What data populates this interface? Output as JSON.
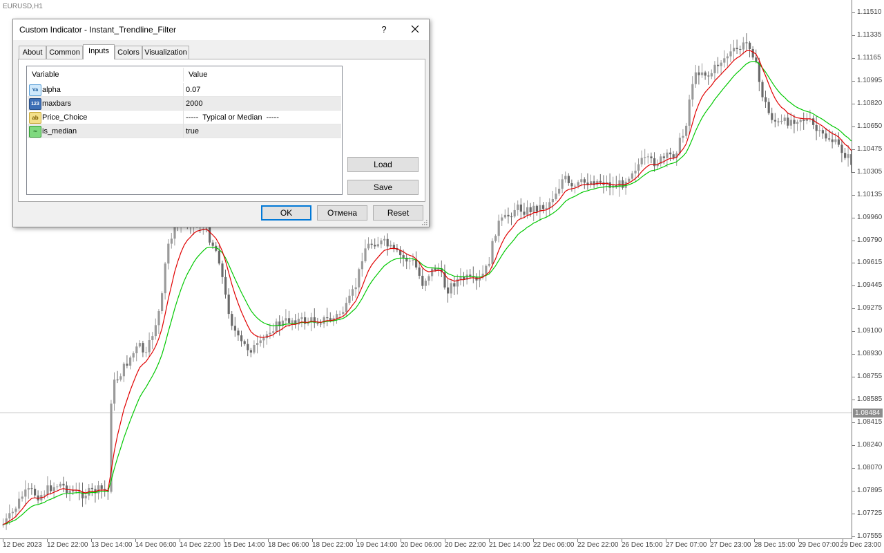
{
  "chart": {
    "symbol": "EURUSD,H1",
    "current_price": "1.08484",
    "price_labels": [
      "1.11510",
      "1.11335",
      "1.11165",
      "1.10995",
      "1.10820",
      "1.10650",
      "1.10475",
      "1.10305",
      "1.10135",
      "1.09960",
      "1.09790",
      "1.09615",
      "1.09445",
      "1.09275",
      "1.09100",
      "1.08930",
      "1.08755",
      "1.08585",
      "1.08415",
      "1.08240",
      "1.08070",
      "1.07895",
      "1.07725",
      "1.07555"
    ],
    "time_labels": [
      "12 Dec 2023",
      "12 Dec 22:00",
      "13 Dec 14:00",
      "14 Dec 06:00",
      "14 Dec 22:00",
      "15 Dec 14:00",
      "18 Dec 06:00",
      "18 Dec 22:00",
      "19 Dec 14:00",
      "20 Dec 06:00",
      "20 Dec 22:00",
      "21 Dec 14:00",
      "22 Dec 06:00",
      "22 Dec 22:00",
      "26 Dec 15:00",
      "27 Dec 07:00",
      "27 Dec 23:00",
      "28 Dec 15:00",
      "29 Dec 07:00",
      "29 Dec 23:00"
    ],
    "colors": {
      "candle": "#9a9a9a",
      "candle_dark": "#6a6a6a",
      "fast_line": "#e00000",
      "slow_line": "#00c800",
      "current_line": "#c8c8c8"
    }
  },
  "dialog": {
    "title": "Custom Indicator - Instant_Trendline_Filter",
    "help_label": "?",
    "tabs": [
      {
        "label": "About"
      },
      {
        "label": "Common"
      },
      {
        "label": "Inputs"
      },
      {
        "label": "Colors"
      },
      {
        "label": "Visualization"
      }
    ],
    "active_tab": "Inputs",
    "grid": {
      "header_variable": "Variable",
      "header_value": "Value",
      "rows": [
        {
          "icon": "Va",
          "icon_name": "double-type-icon",
          "variable": "alpha",
          "value": "0.07"
        },
        {
          "icon": "123",
          "icon_name": "integer-type-icon",
          "variable": "maxbars",
          "value": "2000"
        },
        {
          "icon": "ab",
          "icon_name": "string-type-icon",
          "variable": "Price_Choice",
          "value": "-----  Typical or Median  -----"
        },
        {
          "icon": "~",
          "icon_name": "bool-type-icon",
          "variable": "is_median",
          "value": "true"
        }
      ]
    },
    "buttons": {
      "load": "Load",
      "save": "Save",
      "ok": "OK",
      "cancel": "Отмена",
      "reset": "Reset"
    }
  }
}
